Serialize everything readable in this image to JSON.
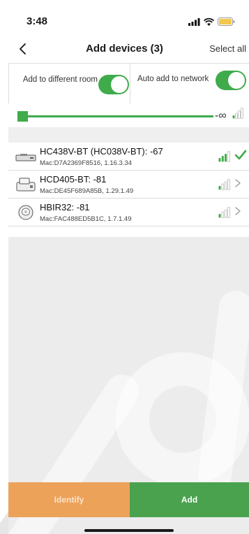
{
  "status_bar": {
    "time": "3:48",
    "icons": [
      "signal-icon",
      "wifi-icon",
      "battery-icon"
    ],
    "battery_color": "#f2c94c"
  },
  "nav": {
    "title": "Add devices (3)",
    "select_all_label": "Select all",
    "back_icon": "chevron-left-icon"
  },
  "options": {
    "add_to_room_label": "Add to different room",
    "add_to_room_on": true,
    "auto_add_label": "Auto add to network",
    "auto_add_on": true
  },
  "slider": {
    "value_label": "-∞",
    "level_fraction": 0.0
  },
  "devices": [
    {
      "name": "HC438V-BT (HC038V-BT): -67",
      "mac": "Mac:D7A2369F8516, 1.16.3.34",
      "signal_bars": 3,
      "selected": true,
      "icon": "bridge-device-icon"
    },
    {
      "name": "HCD405-BT: -81",
      "mac": "Mac:DE45F689A85B, 1.29.1.49",
      "signal_bars": 1,
      "selected": false,
      "icon": "controller-device-icon"
    },
    {
      "name": "HBIR32: -81",
      "mac": "Mac:FAC488ED5B1C, 1.7.1.49",
      "signal_bars": 1,
      "selected": false,
      "icon": "sensor-device-icon"
    }
  ],
  "footer": {
    "identify_label": "Identify",
    "add_label": "Add"
  },
  "colors": {
    "accent_green": "#3fab4b",
    "identify_orange": "#eda25a",
    "add_green": "#4aa24f"
  }
}
